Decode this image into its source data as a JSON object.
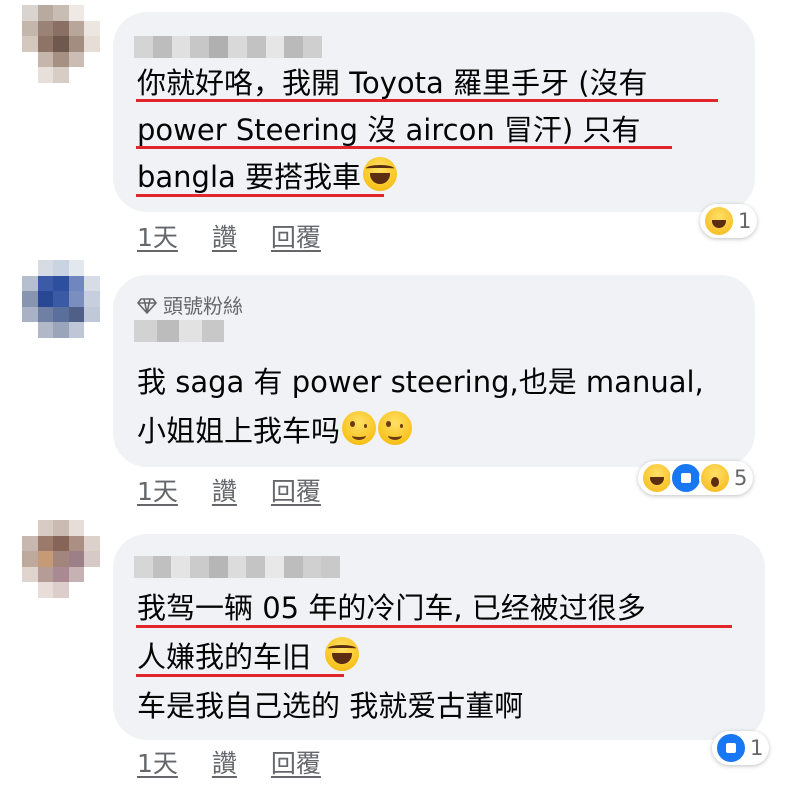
{
  "comments": [
    {
      "author": "",
      "badge": "",
      "lines": [
        "你就好咯，我開 Toyota 羅里手牙 (沒有",
        "power Steering 沒 aircon 冒汗) 只有",
        "bangla 要搭我車"
      ],
      "time": "1天",
      "like_label": "讚",
      "reply_label": "回覆",
      "reaction_count": "1",
      "reactions": [
        "haha-icon"
      ]
    },
    {
      "author": "",
      "badge": "頭號粉絲",
      "lines": [
        "我 saga 有 power steering,也是 manual,",
        "小姐姐上我车吗"
      ],
      "time": "1天",
      "like_label": "讚",
      "reply_label": "回覆",
      "reaction_count": "5",
      "reactions": [
        "haha-icon",
        "like-icon",
        "wow-icon"
      ]
    },
    {
      "author": "",
      "badge": "",
      "lines": [
        "我驾一辆 05 年的冷门车, 已经被过很多",
        "人嫌我的车旧",
        "车是我自己选的 我就爱古董啊"
      ],
      "time": "1天",
      "like_label": "讚",
      "reply_label": "回覆",
      "reaction_count": "1",
      "reactions": [
        "like-icon"
      ]
    }
  ],
  "colors": {
    "bubble": "#f0f2f5",
    "underline": "#e3262b",
    "meta": "#65676b",
    "like_blue": "#1877f2"
  }
}
